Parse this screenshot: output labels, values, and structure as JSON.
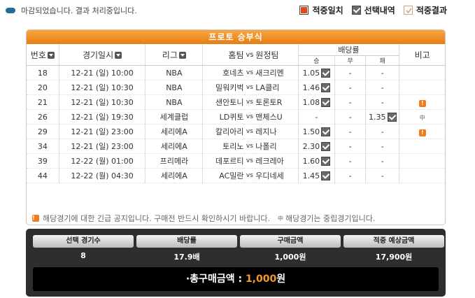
{
  "notice": "마감되었습니다. 결과 처리중입니다.",
  "legend": {
    "hit": "적중일치",
    "selected": "선택내역",
    "result": "적중결과"
  },
  "panel_title": "프로토 승부식",
  "headers": {
    "no": "번호",
    "date": "경기일시",
    "league": "리그",
    "home": "홈팀",
    "vs": "vs",
    "away": "원정팀",
    "odds": "배당률",
    "win": "승",
    "draw": "무",
    "lose": "패",
    "note": "비고"
  },
  "rows": [
    {
      "no": "18",
      "date": "12-21 (일) 10:00",
      "league": "NBA",
      "home": "호네츠",
      "away": "새크리멘",
      "win": "1.05",
      "draw": "-",
      "lose": "-",
      "pick": "win",
      "note": ""
    },
    {
      "no": "20",
      "date": "12-21 (일) 10:30",
      "league": "NBA",
      "home": "밀워키벅",
      "away": "LA클리",
      "win": "1.46",
      "draw": "-",
      "lose": "-",
      "pick": "win",
      "note": ""
    },
    {
      "no": "21",
      "date": "12-21 (일) 10:30",
      "league": "NBA",
      "home": "샌안토니",
      "away": "토론토R",
      "win": "1.08",
      "draw": "-",
      "lose": "-",
      "pick": "win",
      "note": "warn"
    },
    {
      "no": "26",
      "date": "12-21 (일) 19:30",
      "league": "세계클럽",
      "home": "LD퀴토",
      "away": "맨체스U",
      "win": "-",
      "draw": "-",
      "lose": "1.35",
      "pick": "lose",
      "note": "mid"
    },
    {
      "no": "29",
      "date": "12-21 (일) 23:00",
      "league": "세리에A",
      "home": "칼리아리",
      "away": "레지나",
      "win": "1.50",
      "draw": "-",
      "lose": "-",
      "pick": "win",
      "note": "warn"
    },
    {
      "no": "34",
      "date": "12-21 (일) 23:00",
      "league": "세리에A",
      "home": "토리노",
      "away": "나폴리",
      "win": "2.30",
      "draw": "-",
      "lose": "-",
      "pick": "win",
      "note": ""
    },
    {
      "no": "39",
      "date": "12-22 (월) 01:00",
      "league": "프리메라",
      "home": "데포르티",
      "away": "레크레아",
      "win": "1.60",
      "draw": "-",
      "lose": "-",
      "pick": "win",
      "note": ""
    },
    {
      "no": "44",
      "date": "12-22 (월) 04:30",
      "league": "세리에A",
      "home": "AC밀란",
      "away": "우디네세",
      "win": "1.45",
      "draw": "-",
      "lose": "-",
      "pick": "win",
      "note": ""
    }
  ],
  "footnote": {
    "warn_text": "해당경기에 대한 긴급 공지입니다. 구매전 반드시 확인하시기 바랍니다.",
    "mid_icon": "中",
    "mid_text": "해당경기는 중립경기입니다."
  },
  "summary": {
    "labels": [
      "선택 경기수",
      "배당률",
      "구매금액",
      "적중 예상금액"
    ],
    "values": [
      "8",
      "17.9배",
      "1,000원",
      "17,900원"
    ],
    "total_label": "·총구매금액 :",
    "total_amount": "1,000",
    "total_unit": "원"
  },
  "colors": {
    "accent": "#e77d12",
    "summary_bg": "#2e2e2e",
    "amount": "#f09a2a"
  }
}
